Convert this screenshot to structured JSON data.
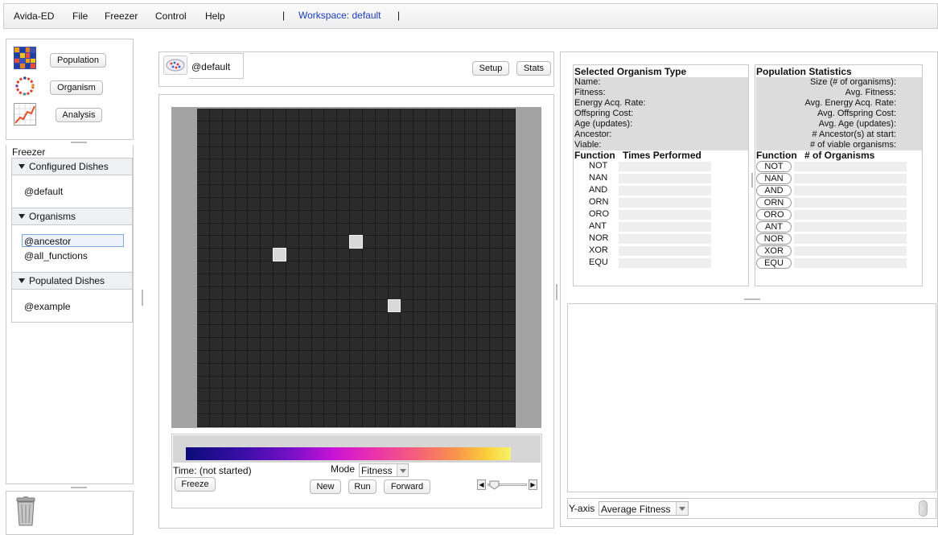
{
  "menubar": {
    "items": [
      "Avida-ED",
      "File",
      "Freezer",
      "Control",
      "Help"
    ],
    "separator": "|",
    "workspace": "Workspace: default"
  },
  "nav": {
    "population": "Population",
    "organism": "Organism",
    "analysis": "Analysis"
  },
  "freezer": {
    "title": "Freezer",
    "configured": {
      "header": "Configured Dishes",
      "items": [
        "@default"
      ]
    },
    "organisms": {
      "header": "Organisms",
      "items": [
        "@ancestor",
        "@all_functions"
      ],
      "selected": 0
    },
    "populated": {
      "header": "Populated Dishes",
      "items": [
        "@example"
      ]
    }
  },
  "dish": {
    "name": "@default",
    "setup": "Setup",
    "stats": "Stats",
    "grid_cols": 25,
    "grid_rows": 25,
    "occupied_cells": [
      [
        6,
        11
      ],
      [
        12,
        10
      ],
      [
        15,
        15
      ]
    ]
  },
  "controls": {
    "time": "Time: (not started)",
    "mode_label": "Mode",
    "mode_value": "Fitness",
    "freeze": "Freeze",
    "new": "New",
    "run": "Run",
    "forward": "Forward"
  },
  "selected_org": {
    "title": "Selected Organism Type",
    "fields": [
      "Name:",
      "Fitness:",
      "Energy Acq. Rate:",
      "Offspring Cost:",
      "Age (updates):",
      "Ancestor:",
      "Viable:"
    ],
    "function_header": "Function",
    "times_header": "Times Performed",
    "functions": [
      "NOT",
      "NAN",
      "AND",
      "ORN",
      "ORO",
      "ANT",
      "NOR",
      "XOR",
      "EQU"
    ]
  },
  "pop_stats": {
    "title": "Population Statistics",
    "fields": [
      "Size (# of organisms):",
      "Avg. Fitness:",
      "Avg. Energy Acq. Rate:",
      "Avg. Offspring Cost:",
      "Avg. Age (updates):",
      "# Ancestor(s) at start:",
      "# of viable organisms:"
    ],
    "function_header": "Function",
    "count_header": "# of Organisms",
    "functions": [
      "NOT",
      "NAN",
      "AND",
      "ORN",
      "ORO",
      "ANT",
      "NOR",
      "XOR",
      "EQU"
    ]
  },
  "graph": {
    "yaxis_label": "Y-axis",
    "yaxis_value": "Average Fitness"
  },
  "icons": {
    "population": "population-grid-icon",
    "organism": "organism-ring-icon",
    "analysis": "analysis-chart-icon",
    "dish": "petri-dish-icon",
    "trash": "trash-can-icon"
  }
}
